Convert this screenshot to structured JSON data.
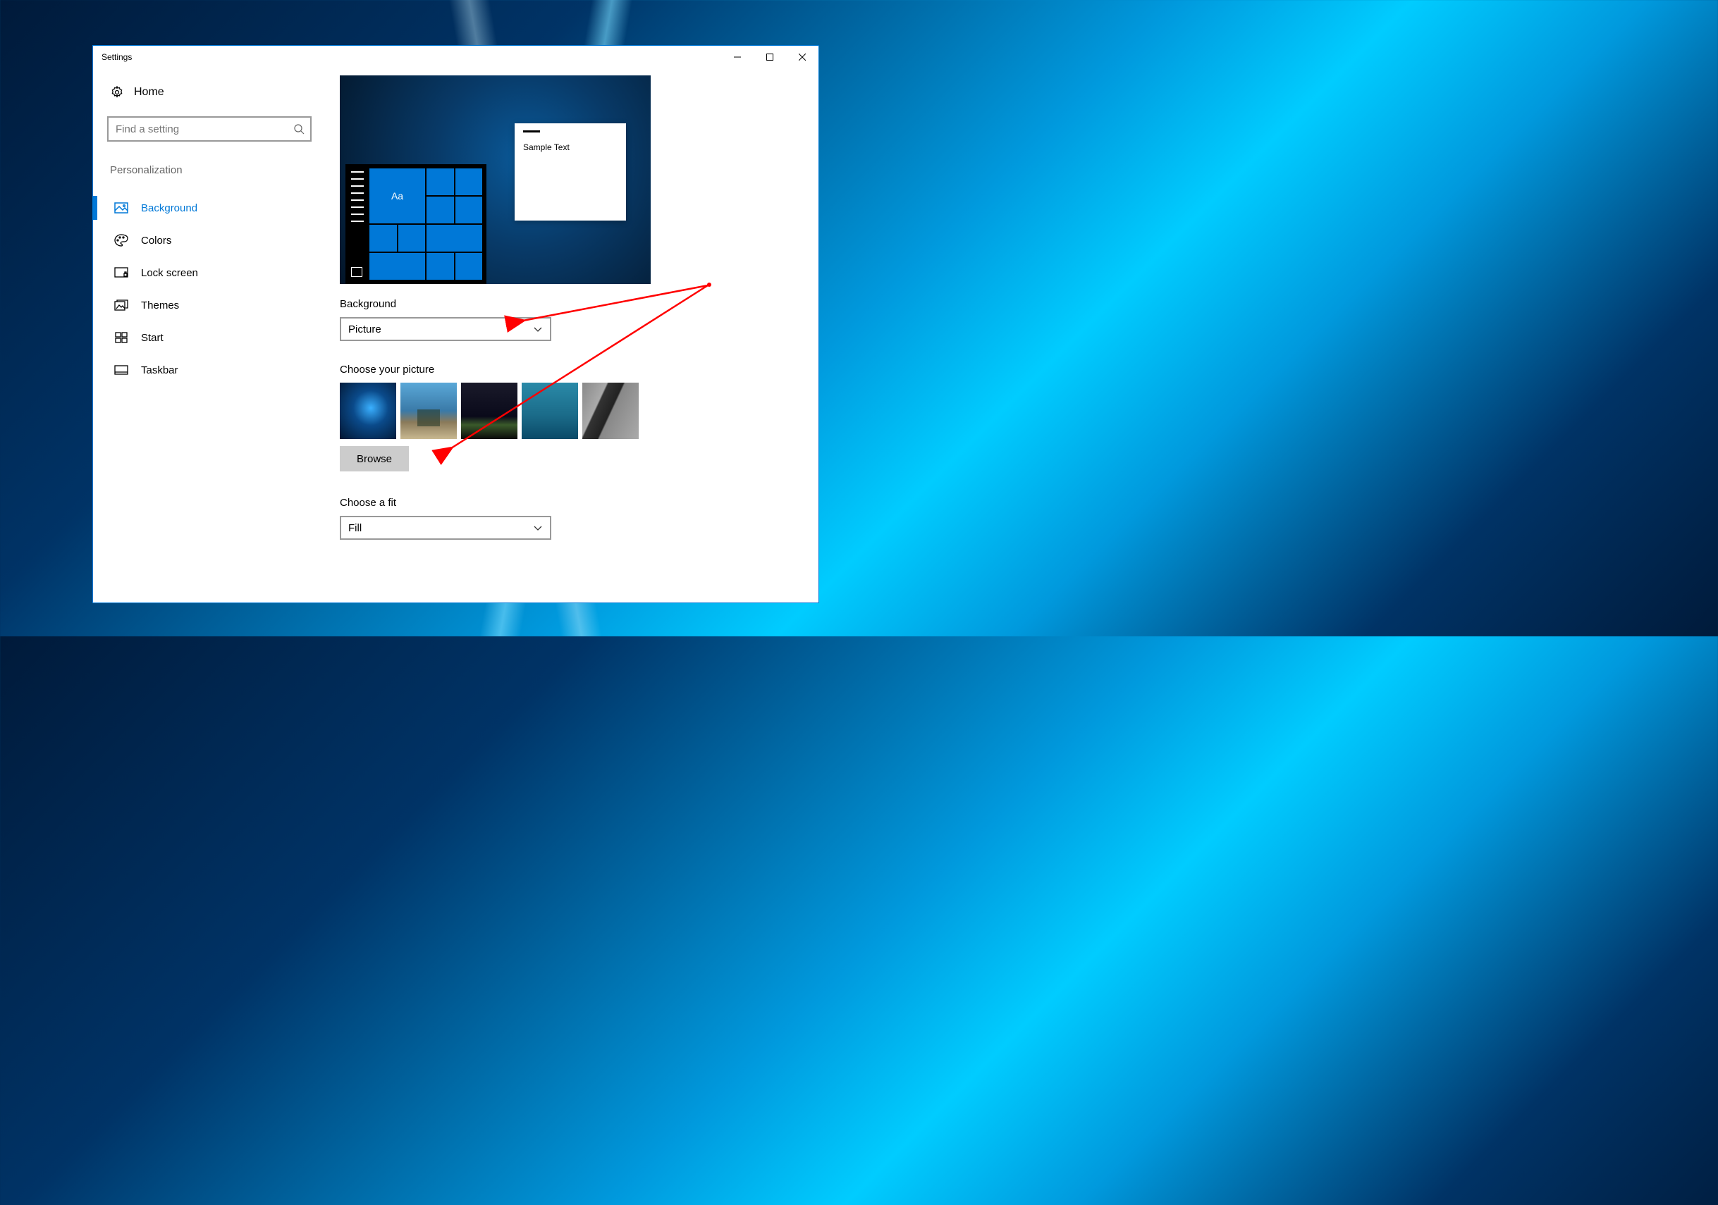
{
  "window": {
    "title": "Settings"
  },
  "sidebar": {
    "home_label": "Home",
    "search_placeholder": "Find a setting",
    "category": "Personalization",
    "items": [
      {
        "label": "Background",
        "active": true
      },
      {
        "label": "Colors"
      },
      {
        "label": "Lock screen"
      },
      {
        "label": "Themes"
      },
      {
        "label": "Start"
      },
      {
        "label": "Taskbar"
      }
    ]
  },
  "preview": {
    "tile_text": "Aa",
    "sample_text": "Sample Text"
  },
  "content": {
    "background_label": "Background",
    "background_value": "Picture",
    "choose_picture_label": "Choose your picture",
    "browse_label": "Browse",
    "choose_fit_label": "Choose a fit",
    "fit_value": "Fill"
  },
  "annotation": {
    "color": "#ff0000"
  }
}
